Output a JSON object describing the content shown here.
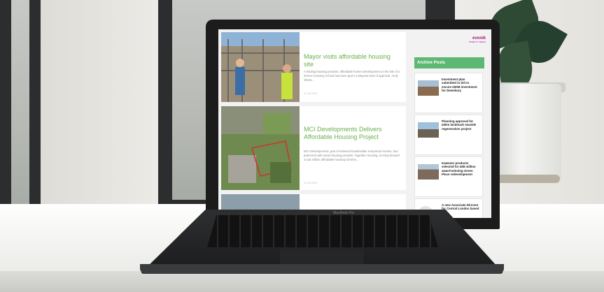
{
  "site": {
    "logo": "evonik",
    "logo_sub": "POWER TO CREATE"
  },
  "posts": [
    {
      "title": "Mayor visits affordable housing site",
      "excerpt": "A leading housing provider, affordable homes development on the site of a former Coventry school has been given a Mayoral seal of approval. Andy Street...",
      "date": "12 Oct 2023"
    },
    {
      "title": "MCI Developments Delivers Affordable Housing Project",
      "excerpt": "MCI Developments, part of national housebuilder Keepmoat Homes, has partnered with social housing provider, Together Housing, to bring forward a £15 million affordable housing scheme...",
      "date": "10 Oct 2023"
    }
  ],
  "sidebar": {
    "archive_title": "Archive Posts",
    "cards": [
      {
        "text": "Investment plan submitted in bid to secure £50M investment for Dewsbury"
      },
      {
        "text": "Planning approval for £50m landmark seaside regeneration project"
      },
      {
        "text": "Kawneer products selected for £88 million award-winning Green Place redevelopment"
      },
      {
        "text": "A new Associate Director for Central London based"
      }
    ]
  },
  "laptop": {
    "brand": "MacBook Pro"
  },
  "colors": {
    "accent_green": "#5db873",
    "title_green": "#6ab04c",
    "logo_purple": "#a0197d"
  }
}
